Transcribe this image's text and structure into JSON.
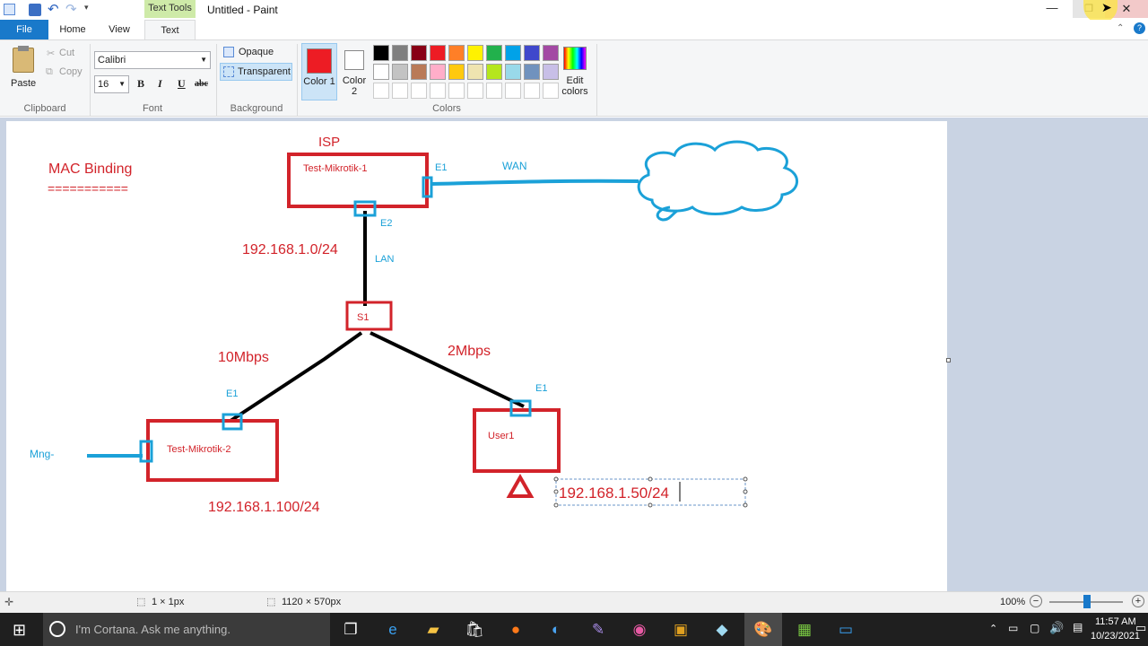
{
  "window": {
    "title": "Untitled - Paint",
    "context_tab": "Text Tools"
  },
  "ribbon_tabs": [
    "File",
    "Home",
    "View",
    "Text"
  ],
  "clipboard": {
    "paste": "Paste",
    "cut": "Cut",
    "copy": "Copy",
    "group": "Clipboard"
  },
  "font": {
    "family": "Calibri",
    "size": "16",
    "group": "Font",
    "bold": "B",
    "italic": "I",
    "underline": "U",
    "strike": "abc"
  },
  "background": {
    "opaque": "Opaque",
    "transparent": "Transparent",
    "group": "Background"
  },
  "colors": {
    "color1": "Color 1",
    "color2": "Color 2",
    "edit": "Edit colors",
    "group": "Colors",
    "color1_value": "#ed1c24",
    "color2_value": "#ffffff",
    "palette_row1": [
      "#000000",
      "#7f7f7f",
      "#880015",
      "#ed1c24",
      "#ff7f27",
      "#fff200",
      "#22b14c",
      "#00a2e8",
      "#3f48cc",
      "#a349a4"
    ],
    "palette_row2": [
      "#ffffff",
      "#c3c3c3",
      "#b97a57",
      "#ffaec9",
      "#ffc90e",
      "#efe4b0",
      "#b5e61d",
      "#99d9ea",
      "#7092be",
      "#c8bfe7"
    ]
  },
  "diagram": {
    "title": "MAC Binding",
    "underline": "===========",
    "isp": "ISP",
    "router1": "Test-Mikrotik-1",
    "router1_e1": "E1",
    "router1_e2": "E2",
    "wan": "WAN",
    "lan": "LAN",
    "subnet": "192.168.1.0/24",
    "switch": "S1",
    "speed_left": "10Mbps",
    "speed_right": "2Mbps",
    "router2": "Test-Mikrotik-2",
    "router2_e1": "E1",
    "router2_ip": "192.168.1.100/24",
    "mng": "Mng-",
    "user": "User1",
    "user_e1": "E1",
    "user_ip": "192.168.1.50/24",
    "red": "#d2232a",
    "blue": "#1ba1d8"
  },
  "status": {
    "selection": "1 × 1px",
    "canvas_size": "1120 × 570px",
    "zoom": "100%"
  },
  "taskbar": {
    "search": "I'm Cortana. Ask me anything.",
    "time": "11:57 AM",
    "date": "10/23/2021"
  }
}
